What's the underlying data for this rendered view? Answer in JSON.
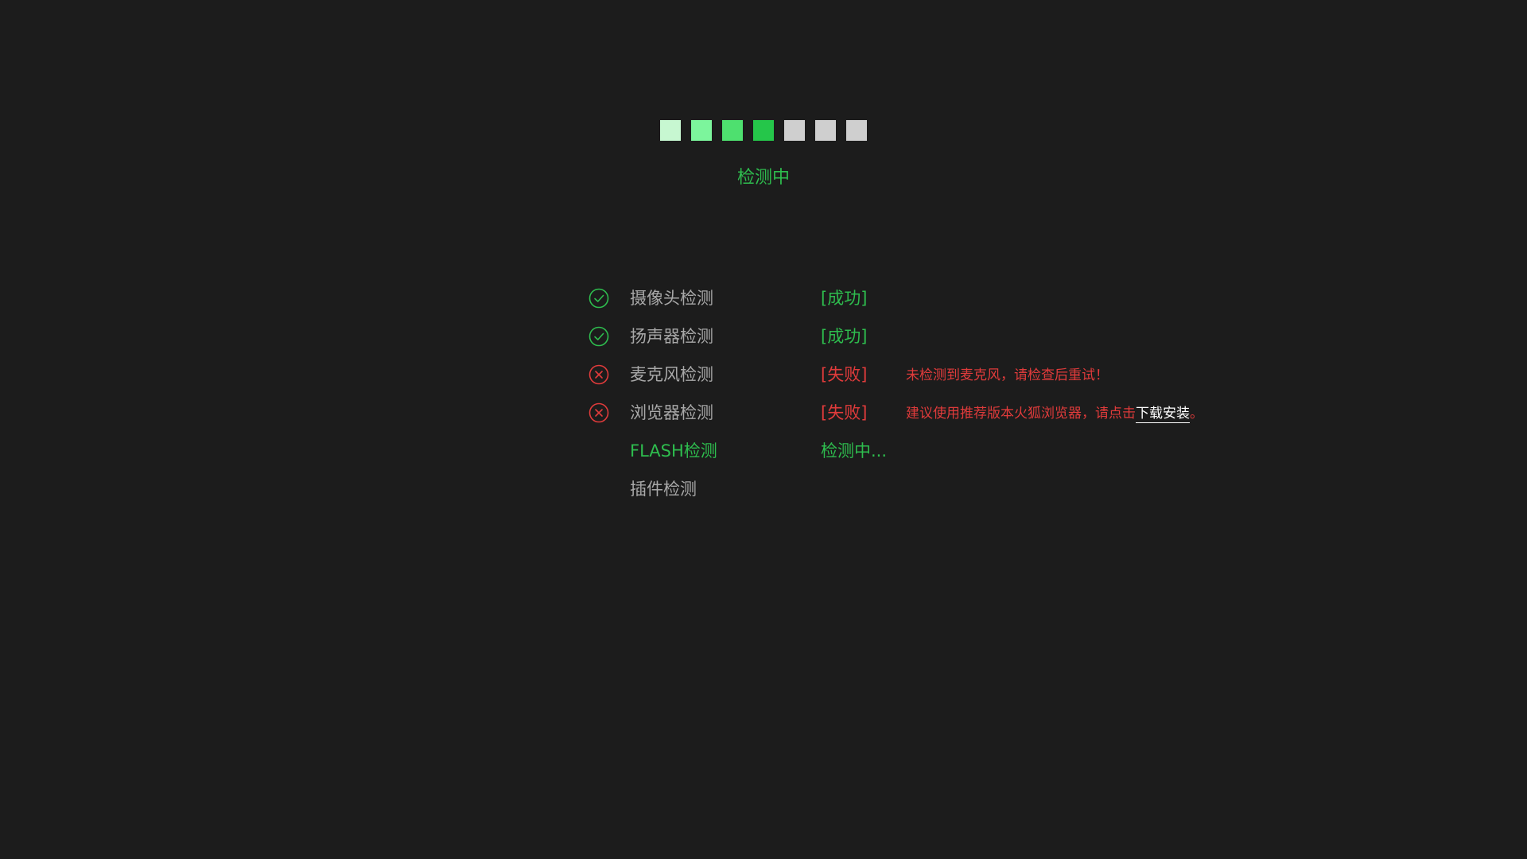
{
  "colors": {
    "background": "#1c1c1c",
    "success": "#2ebd4e",
    "fail": "#e03b3b",
    "neutral_text": "#a8a8a8",
    "link": "#ffffff"
  },
  "progress": {
    "squares": [
      {
        "state": "done",
        "color": "#c7f7d1"
      },
      {
        "state": "done",
        "color": "#7cf59c"
      },
      {
        "state": "done",
        "color": "#4ee06f"
      },
      {
        "state": "done",
        "color": "#25c64a"
      },
      {
        "state": "pending",
        "color": "#cfcfcf"
      },
      {
        "state": "pending",
        "color": "#cfcfcf"
      },
      {
        "state": "pending",
        "color": "#cfcfcf"
      }
    ]
  },
  "status_title": "检测中",
  "checks": [
    {
      "icon": "check-circle-icon",
      "label": "摄像头检测",
      "result": "[成功]",
      "state": "success",
      "message": "",
      "link": "",
      "message_suffix": ""
    },
    {
      "icon": "check-circle-icon",
      "label": "扬声器检测",
      "result": "[成功]",
      "state": "success",
      "message": "",
      "link": "",
      "message_suffix": ""
    },
    {
      "icon": "x-circle-icon",
      "label": "麦克风检测",
      "result": "[失败]",
      "state": "fail",
      "message": "未检测到麦克风，请检查后重试！",
      "link": "",
      "message_suffix": ""
    },
    {
      "icon": "x-circle-icon",
      "label": "浏览器检测",
      "result": "[失败]",
      "state": "fail",
      "message": "建议使用推荐版本火狐浏览器，请点击",
      "link": "下载安装",
      "message_suffix": "。"
    },
    {
      "icon": "",
      "label": "FLASH检测",
      "result": "检测中...",
      "state": "running",
      "message": "",
      "link": "",
      "message_suffix": ""
    },
    {
      "icon": "",
      "label": "插件检测",
      "result": "",
      "state": "pending",
      "message": "",
      "link": "",
      "message_suffix": ""
    }
  ]
}
